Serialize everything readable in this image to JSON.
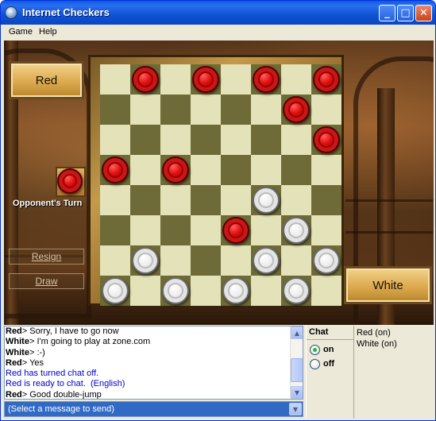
{
  "window": {
    "title": "Internet Checkers"
  },
  "titlebar": {
    "minimize": "_",
    "maximize": "□",
    "close": "✕"
  },
  "menu": {
    "items": [
      "Game",
      "Help"
    ]
  },
  "game": {
    "top_player": "Red",
    "bottom_player": "White",
    "turn_label": "Opponent's Turn",
    "resign_label": "Resign",
    "draw_label": "Draw",
    "pieces": {
      "red": [
        [
          0,
          1
        ],
        [
          0,
          3
        ],
        [
          0,
          5
        ],
        [
          0,
          7
        ],
        [
          1,
          6
        ],
        [
          2,
          7
        ],
        [
          3,
          0
        ],
        [
          3,
          2
        ],
        [
          5,
          4
        ]
      ],
      "white": [
        [
          4,
          5
        ],
        [
          5,
          6
        ],
        [
          6,
          1
        ],
        [
          6,
          5
        ],
        [
          6,
          7
        ],
        [
          7,
          0
        ],
        [
          7,
          2
        ],
        [
          7,
          4
        ],
        [
          7,
          6
        ]
      ]
    }
  },
  "chat": {
    "lines": [
      {
        "who": "Red",
        "sep": "> ",
        "text": "Sorry, I have to go now",
        "system": false
      },
      {
        "who": "White",
        "sep": "> ",
        "text": "I'm going to play at zone.com",
        "system": false
      },
      {
        "who": "White",
        "sep": "> ",
        "text": ":-)",
        "system": false
      },
      {
        "who": "Red",
        "sep": "> ",
        "text": "Yes",
        "system": false
      },
      {
        "who": "",
        "sep": "",
        "text": "Red has turned chat off.",
        "system": true
      },
      {
        "who": "",
        "sep": "",
        "text": "Red is ready to chat.  (English)",
        "system": true
      },
      {
        "who": "Red",
        "sep": "> ",
        "text": "Good double-jump",
        "system": false
      }
    ],
    "send_placeholder": "(Select a message to send)",
    "header": "Chat",
    "on_label": "on",
    "off_label": "off",
    "selected": "on",
    "players": [
      "Red (on)",
      "White (on)"
    ]
  }
}
